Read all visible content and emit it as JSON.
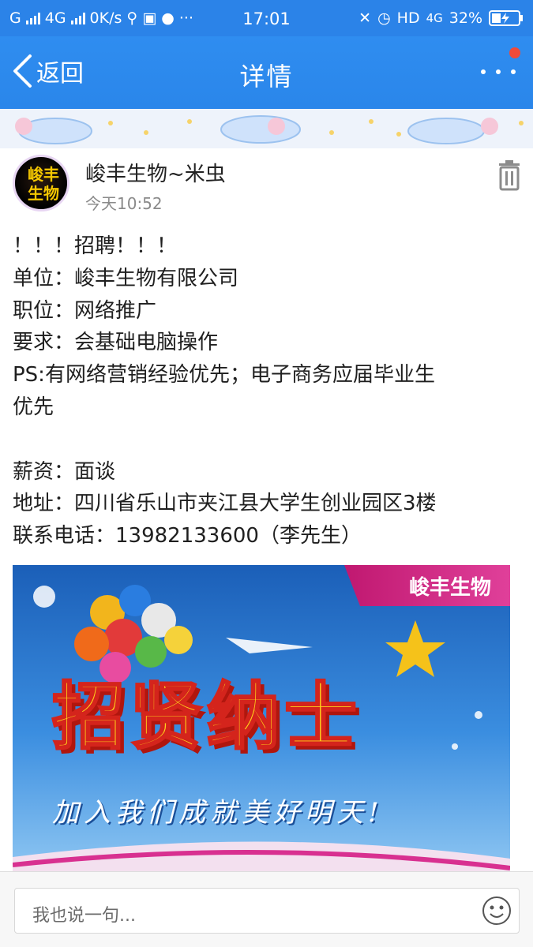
{
  "status_bar": {
    "carrier": "G",
    "network": "4G",
    "speed": "0K/s",
    "time": "17:01",
    "hd": "HD",
    "network2": "4G",
    "battery": "32%"
  },
  "nav": {
    "back_label": "返回",
    "title": "详情"
  },
  "post": {
    "author": "峻丰生物~米虫",
    "time": "今天10:52",
    "avatar_text": "峻丰生物",
    "lines": [
      "！！！招聘！！！",
      "单位：峻丰生物有限公司",
      "职位：网络推广",
      "要求：会基础电脑操作",
      "PS:有网络营销经验优先；电子商务应届毕业生",
      "优先",
      "",
      "薪资：面谈",
      "地址：四川省乐山市夹江县大学生创业园区3楼",
      "联系电话：13982133600（李先生）"
    ]
  },
  "banner": {
    "brand": "峻丰生物",
    "headline": "招贤纳士",
    "slogan": "加入我们成就美好明天!"
  },
  "comment": {
    "placeholder": "我也说一句..."
  },
  "colors": {
    "nav_blue": "#2b83e8",
    "notification_red": "#f04a3a",
    "banner_headline": "#ffd21a"
  }
}
